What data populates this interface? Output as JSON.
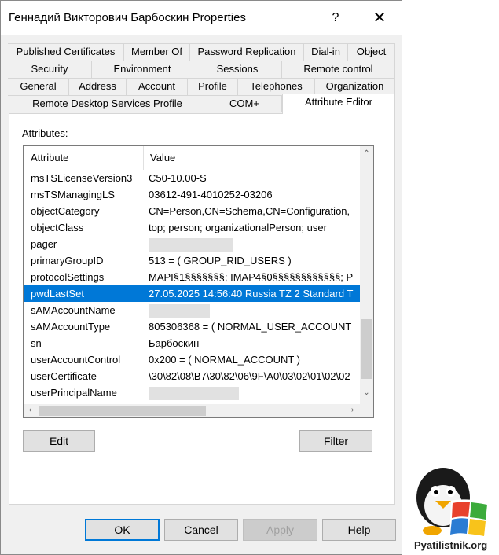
{
  "window": {
    "title": "Геннадий Викторович Барбоскин Properties",
    "help": "?",
    "close": "✕"
  },
  "tabs": {
    "row1": [
      "Published Certificates",
      "Member Of",
      "Password Replication",
      "Dial-in",
      "Object"
    ],
    "row2": [
      "Security",
      "Environment",
      "Sessions",
      "Remote control"
    ],
    "row3": [
      "General",
      "Address",
      "Account",
      "Profile",
      "Telephones",
      "Organization"
    ],
    "row4": [
      "Remote Desktop Services Profile",
      "COM+",
      "Attribute Editor"
    ]
  },
  "panel": {
    "attributes_label": "Attributes:"
  },
  "list": {
    "headers": {
      "attribute": "Attribute",
      "value": "Value"
    },
    "rows": [
      {
        "attr": "msTSLicenseVersion3",
        "value": "C50-10.00-S"
      },
      {
        "attr": "msTSManagingLS",
        "value": "03612-491-4010252-03206"
      },
      {
        "attr": "objectCategory",
        "value": "CN=Person,CN=Schema,CN=Configuration,"
      },
      {
        "attr": "objectClass",
        "value": "top; person; organizationalPerson; user"
      },
      {
        "attr": "pager",
        "value": ""
      },
      {
        "attr": "primaryGroupID",
        "value": "513 = ( GROUP_RID_USERS )"
      },
      {
        "attr": "protocolSettings",
        "value": "MAPI§1§§§§§§§; IMAP4§0§§§§§§§§§§§§; P"
      },
      {
        "attr": "pwdLastSet",
        "value": "27.05.2025 14:56:40 Russia TZ 2 Standard T"
      },
      {
        "attr": "sAMAccountName",
        "value": ""
      },
      {
        "attr": "sAMAccountType",
        "value": "805306368 = ( NORMAL_USER_ACCOUNT"
      },
      {
        "attr": "sn",
        "value": "Барбоскин"
      },
      {
        "attr": "userAccountControl",
        "value": "0x200 = ( NORMAL_ACCOUNT )"
      },
      {
        "attr": "userCertificate",
        "value": "\\30\\82\\08\\B7\\30\\82\\06\\9F\\A0\\03\\02\\01\\02\\02"
      },
      {
        "attr": "userPrincipalName",
        "value": ""
      }
    ]
  },
  "buttons": {
    "edit": "Edit",
    "filter": "Filter",
    "ok": "OK",
    "cancel": "Cancel",
    "apply": "Apply",
    "help": "Help"
  },
  "watermark": {
    "text": "Pyatilistnik.org"
  },
  "colors": {
    "selection": "#0078d7",
    "dialog_bg": "#f0f0f0",
    "button_bg": "#e1e1e1"
  }
}
